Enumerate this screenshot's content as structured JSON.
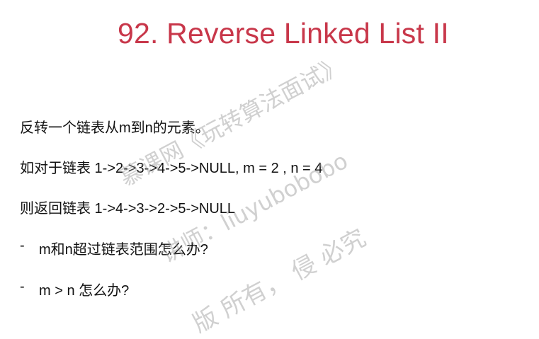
{
  "title": "92. Reverse Linked List II",
  "body": {
    "line1": "反转一个链表从m到n的元素。",
    "line2": "如对于链表 1->2->3->4->5->NULL, m = 2 , n = 4",
    "line3": "则返回链表 1->4->3->2->5->NULL",
    "bullets": [
      {
        "marker": "-",
        "text": "m和n超过链表范围怎么办?"
      },
      {
        "marker": "-",
        "text": "m > n 怎么办?"
      }
    ]
  },
  "watermark": {
    "line1": "慕课网《玩转算法面试》",
    "line2": "讲师：liuyubobobo",
    "line3": "版    所有， 侵    必究"
  },
  "colors": {
    "title": "#C8374A",
    "text": "#111111"
  }
}
